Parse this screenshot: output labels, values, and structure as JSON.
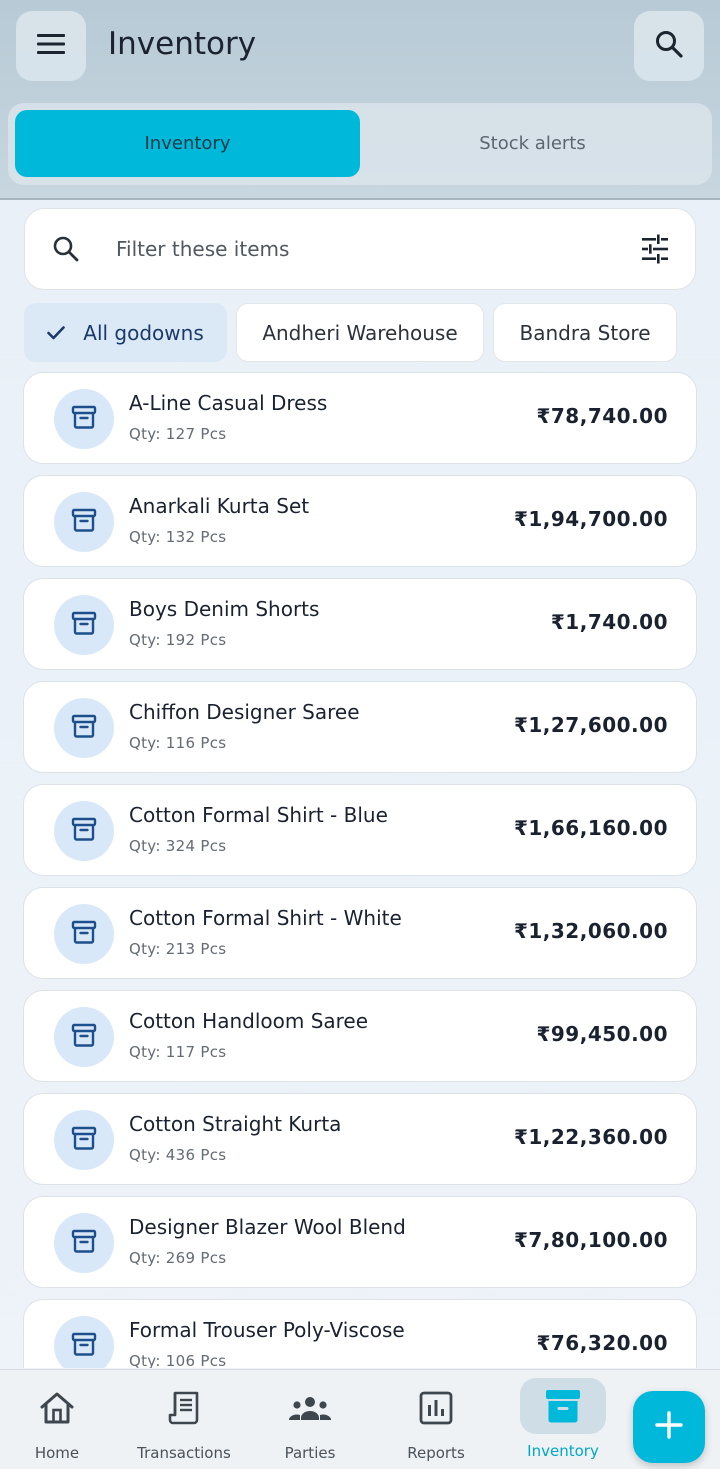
{
  "header": {
    "title": "Inventory",
    "menu_icon": "hamburger-menu-icon",
    "search_icon": "search-icon"
  },
  "tabs": [
    {
      "label": "Inventory",
      "active": true
    },
    {
      "label": "Stock alerts",
      "active": false
    }
  ],
  "filter": {
    "placeholder": "Filter these items",
    "filter_icon": "tune-sliders-icon"
  },
  "godowns": [
    {
      "label": "All godowns",
      "selected": true
    },
    {
      "label": "Andheri Warehouse",
      "selected": false
    },
    {
      "label": "Bandra Store",
      "selected": false
    }
  ],
  "items": [
    {
      "name": "A-Line Casual Dress",
      "qty": "Qty: 127 Pcs",
      "amount": "₹78,740.00"
    },
    {
      "name": "Anarkali Kurta Set",
      "qty": "Qty: 132 Pcs",
      "amount": "₹1,94,700.00"
    },
    {
      "name": "Boys Denim Shorts",
      "qty": "Qty: 192 Pcs",
      "amount": "₹1,740.00"
    },
    {
      "name": "Chiffon Designer Saree",
      "qty": "Qty: 116 Pcs",
      "amount": "₹1,27,600.00"
    },
    {
      "name": "Cotton Formal Shirt - Blue",
      "qty": "Qty: 324 Pcs",
      "amount": "₹1,66,160.00"
    },
    {
      "name": "Cotton Formal Shirt - White",
      "qty": "Qty: 213 Pcs",
      "amount": "₹1,32,060.00"
    },
    {
      "name": "Cotton Handloom Saree",
      "qty": "Qty: 117 Pcs",
      "amount": "₹99,450.00"
    },
    {
      "name": "Cotton Straight Kurta",
      "qty": "Qty: 436 Pcs",
      "amount": "₹1,22,360.00"
    },
    {
      "name": "Designer Blazer Wool Blend",
      "qty": "Qty: 269 Pcs",
      "amount": "₹7,80,100.00"
    },
    {
      "name": "Formal Trouser Poly-Viscose",
      "qty": "Qty: 106 Pcs",
      "amount": "₹76,320.00"
    }
  ],
  "bottom_nav": [
    {
      "label": "Home",
      "icon": "home-icon",
      "active": false
    },
    {
      "label": "Transactions",
      "icon": "receipt-icon",
      "active": false
    },
    {
      "label": "Parties",
      "icon": "group-icon",
      "active": false
    },
    {
      "label": "Reports",
      "icon": "bar-chart-icon",
      "active": false
    },
    {
      "label": "Inventory",
      "icon": "archive-box-icon",
      "active": true
    }
  ],
  "fab_icon": "plus-icon",
  "colors": {
    "accent": "#00b8d9",
    "chip_selected_bg": "#dbe9f6",
    "item_badge_bg": "#d9e8f8",
    "item_icon": "#1d4f8c"
  }
}
